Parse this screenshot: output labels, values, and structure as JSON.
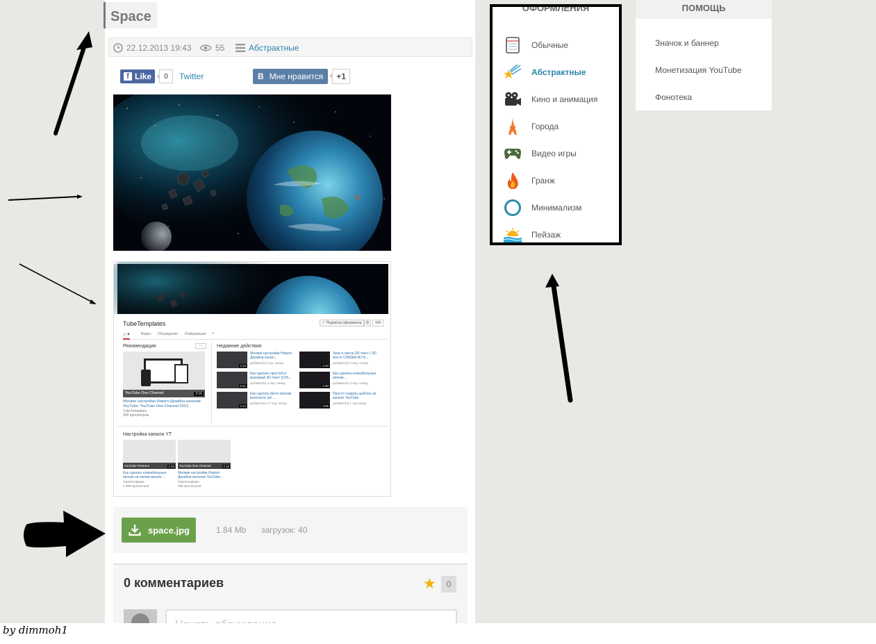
{
  "post": {
    "title": "Space",
    "date": "22.12.2013 19:43",
    "views": "55",
    "category": "Абстрактные"
  },
  "share": {
    "fb_label": "Like",
    "fb_count": "0",
    "twitter_label": "Twitter",
    "vk_label": "Мне нравится",
    "vk_count": "+1"
  },
  "preview": {
    "channel_name": "TubeTemplates",
    "subscribe_label": "✓ Подписка оформлена",
    "subscribe_count": "999",
    "nav_tabs": [
      "Видео",
      "Обсуждение",
      "Информация"
    ],
    "rec_heading": "Рекомендации",
    "rec_title": "Мелкие настройки Нового Дизайна каналов YouTube: YouTube One Channel 2013.",
    "rec_author": "TubeTemplates",
    "rec_views": "399 просмотров",
    "rec_overlay": "YouTube One Channel",
    "rec_duration": "3:16",
    "recent_heading": "Недавние действия",
    "recent": [
      {
        "title": "Мелкие настройки Нового Дизайна канал...",
        "meta": "добавил(а) 5 дн. назад",
        "duration": "3:16"
      },
      {
        "title": "Урок и смена 3D-текст | 3D-text in CINEMA 4D fo...",
        "meta": "добавил(а) 3 нед. назад",
        "duration": "4:20"
      },
      {
        "title": "Как сделать простой и красивый 3D-текст [CIN...",
        "meta": "добавил(а) 3 нед. назад",
        "duration": "5:21"
      },
      {
        "title": "Как сделать кликабельные иконки ...",
        "meta": "добавил(а) 4 нед. назад",
        "duration": "2:30"
      },
      {
        "title": "Как сделать фото-коллаж вконтакте (не ...",
        "meta": "добавил(а) 17 нед. назад",
        "duration": "2:14"
      },
      {
        "title": "Просто создать шаблон на канале YouTube",
        "meta": "добавил(а) 1 год назад",
        "duration": "3:05"
      }
    ],
    "settings_heading": "Настройка канала YT",
    "settings_videos": [
      {
        "title": "Как сделать кликабельные иконки на своем канале ...",
        "author": "TubeTemplates",
        "views": "2 398 просмотров",
        "overlay": "YouTube Partners",
        "duration": "2:30"
      },
      {
        "title": "Мелкие настройки Нового Дизайна каналов YouTube...",
        "author": "TubeTemplates",
        "views": "399 просмотров",
        "overlay": "YouTube One Channel",
        "duration": "3:16"
      }
    ]
  },
  "download": {
    "filename": "space.jpg",
    "size": "1.84 Mb",
    "downloads": "загрузок: 40"
  },
  "comments": {
    "title": "0 комментариев",
    "count": "0",
    "placeholder": "Начать обсуждение..."
  },
  "categories": {
    "heading": "ОФОРМЛЕНИЯ",
    "items": [
      {
        "label": "Обычные",
        "icon": "notebook-icon"
      },
      {
        "label": "Абстрактные",
        "icon": "shooting-star-icon",
        "active": true
      },
      {
        "label": "Кино и анимация",
        "icon": "movie-camera-icon"
      },
      {
        "label": "Города",
        "icon": "tower-icon"
      },
      {
        "label": "Видео игры",
        "icon": "gamepad-icon"
      },
      {
        "label": "Гранж",
        "icon": "flame-icon"
      },
      {
        "label": "Минимализм",
        "icon": "circle-icon"
      },
      {
        "label": "Пейзаж",
        "icon": "sunset-icon"
      }
    ]
  },
  "help": {
    "heading": "ПОМОЩЬ",
    "items": [
      "Значок и баннер",
      "Монетизация YouTube",
      "Фонотека"
    ]
  },
  "credit": "by dimmoh1",
  "colors": {
    "accent_link": "#2c86a8",
    "download_green": "#6aa14a",
    "facebook": "#4b67a1",
    "vk": "#5b7fa6"
  }
}
